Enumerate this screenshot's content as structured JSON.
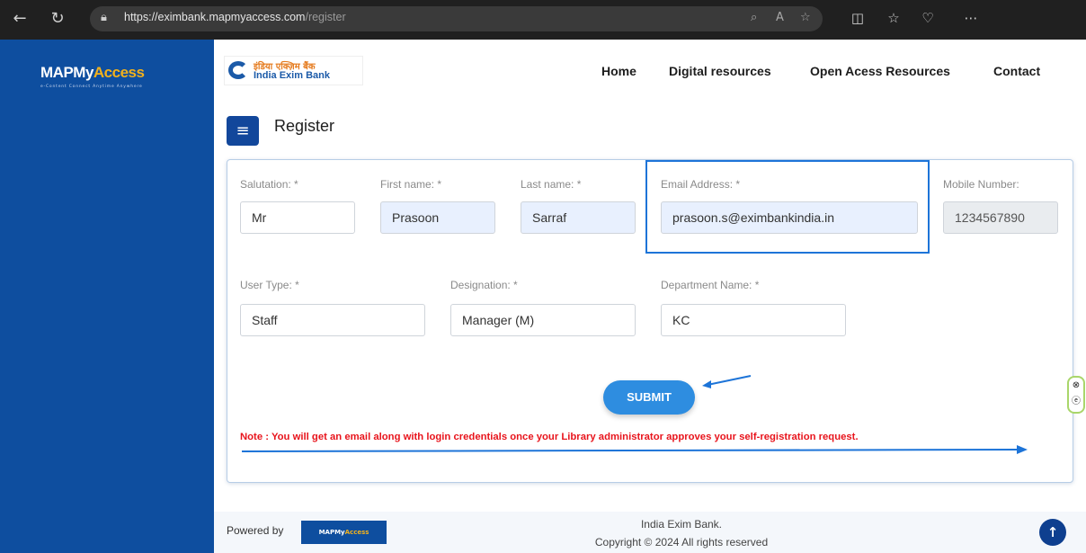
{
  "browser": {
    "url_host": "https://eximbank.mapmyaccess.com",
    "url_path": "/register"
  },
  "sidebar": {
    "logo_main": "MAPMy",
    "logo_accent": "Access",
    "tagline": "e-Content Connect Anytime Anywhere"
  },
  "header": {
    "bank_hindi": "इंडिया एक्ज़िम बैंक",
    "bank_name": "India Exim Bank",
    "menu": [
      "Home",
      "Digital resources",
      "Open Acess Resources",
      "Contact"
    ]
  },
  "page": {
    "title": "Register"
  },
  "form": {
    "salutation": {
      "label": "Salutation: *",
      "value": "Mr"
    },
    "first_name": {
      "label": "First name: *",
      "value": "Prasoon"
    },
    "last_name": {
      "label": "Last name: *",
      "value": "Sarraf"
    },
    "email": {
      "label": "Email Address: *",
      "value": "prasoon.s@eximbankindia.in"
    },
    "mobile": {
      "label": "Mobile Number:",
      "value": "1234567890"
    },
    "user_type": {
      "label": "User Type: *",
      "value": "Staff"
    },
    "designation": {
      "label": "Designation: *",
      "value": "Manager (M)"
    },
    "department": {
      "label": "Department Name: *",
      "value": "KC"
    },
    "submit_label": "SUBMIT",
    "note": "Note : You will get an email along with login credentials once your Library administrator approves your self-registration request."
  },
  "footer": {
    "powered_by": "Powered by",
    "logo_main": "MAPMy",
    "logo_accent": "Access",
    "org": "India Exim Bank.",
    "copyright": "Copyright © 2024 All rights reserved"
  },
  "colors": {
    "sidebar": "#0e4e9f",
    "accent": "#2e8de0",
    "note": "#e8141c",
    "highlight": "#1d74d8"
  }
}
